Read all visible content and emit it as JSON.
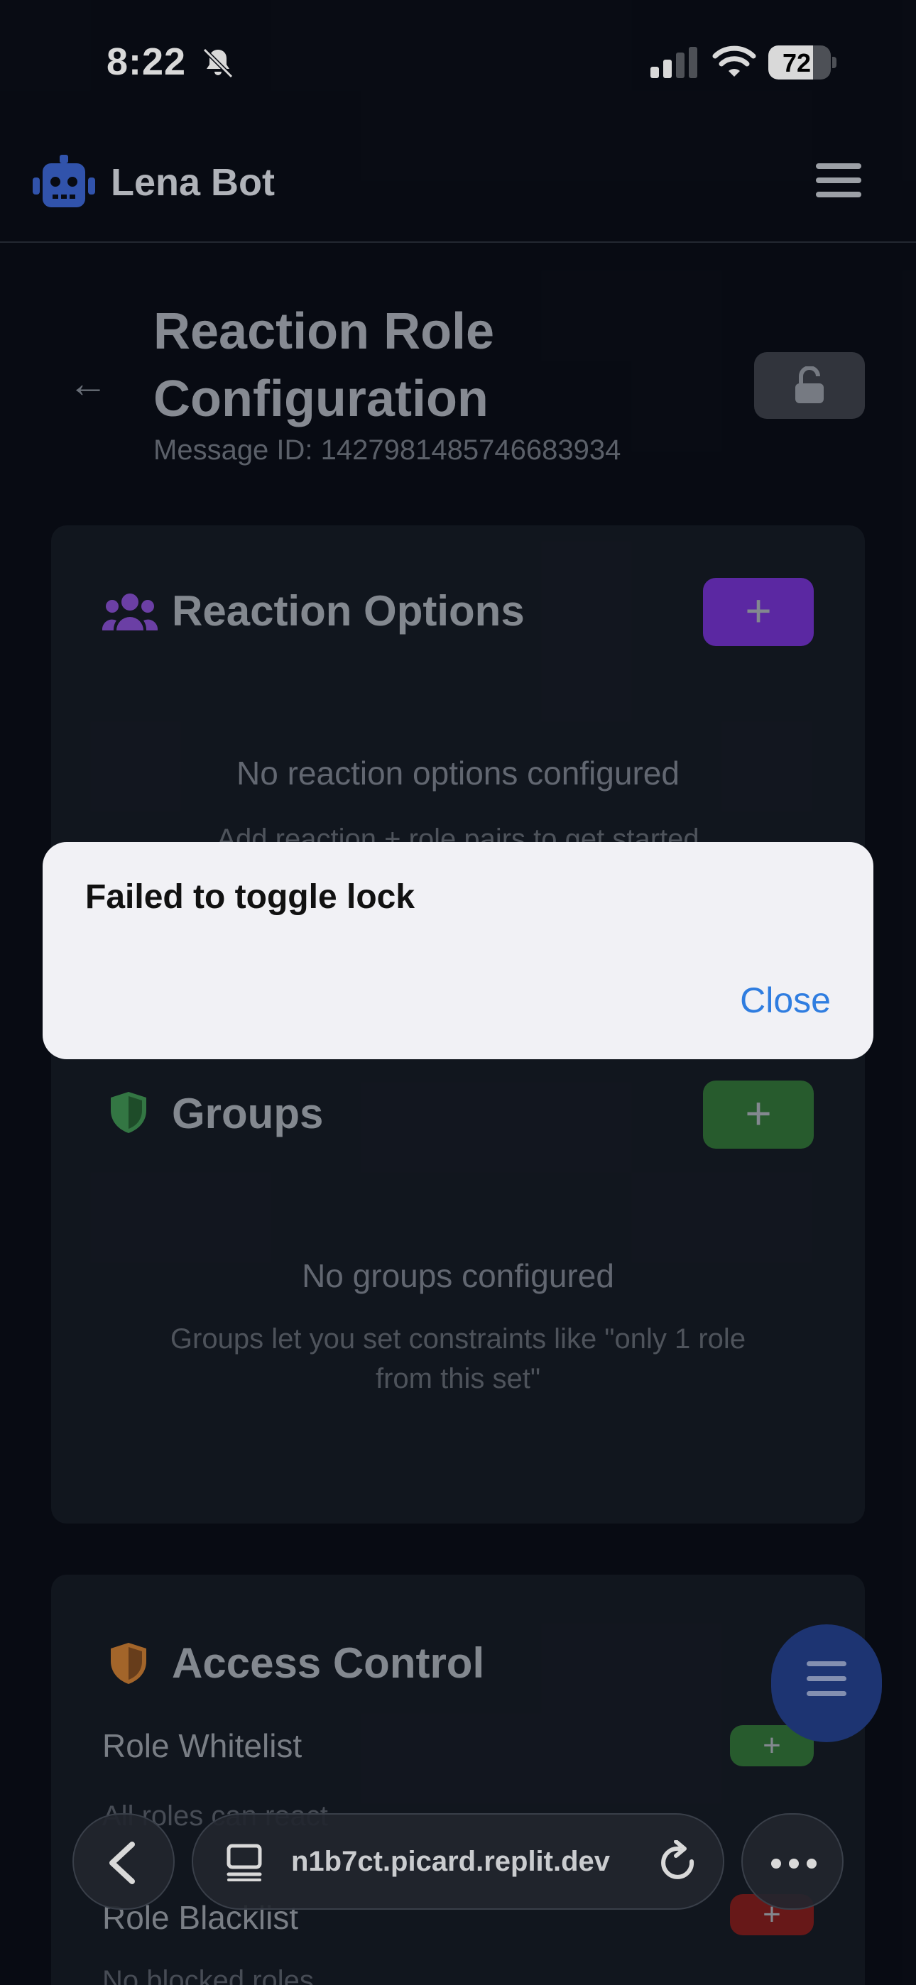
{
  "status_bar": {
    "time": "8:22",
    "battery": "72",
    "battery_level": 0.72
  },
  "header": {
    "brand": "Lena Bot"
  },
  "page": {
    "title": "Reaction Role Configuration",
    "message_id": "Message ID: 1427981485746683934"
  },
  "reaction_options": {
    "heading": "Reaction Options",
    "empty_title": "No reaction options configured",
    "empty_sub": "Add reaction + role pairs to get started"
  },
  "groups": {
    "heading": "Groups",
    "empty_title": "No groups configured",
    "empty_sub": "Groups let you set constraints like \"only 1 role from this set\""
  },
  "access_control": {
    "heading": "Access Control",
    "whitelist_label": "Role Whitelist",
    "whitelist_sub": "All roles can react",
    "blacklist_label": "Role Blacklist",
    "blacklist_sub": "No blocked roles"
  },
  "dialog": {
    "title": "Failed to toggle lock",
    "close_label": "Close"
  },
  "browser": {
    "url": "n1b7ct.picard.replit.dev"
  },
  "icons": {
    "bell": "bell-slash-icon",
    "signal": "cellular-signal-icon",
    "wifi": "wifi-icon",
    "bot": "robot-icon",
    "menu": "hamburger-menu-icon",
    "back": "arrow-left-icon",
    "lock": "unlock-icon",
    "users": "users-icon",
    "shield_green": "shield-icon",
    "shield_orange": "shield-icon",
    "plus": "plus-icon",
    "tabs": "tabs-icon",
    "reload": "reload-icon",
    "more": "more-dots-icon",
    "chevron": "chevron-left-icon"
  },
  "colors": {
    "purple_accent": "#6b2fbf",
    "green_accent": "#2e6b36",
    "red_accent": "#7a1d1d",
    "fab": "#233e86",
    "link": "#2f7de0"
  }
}
